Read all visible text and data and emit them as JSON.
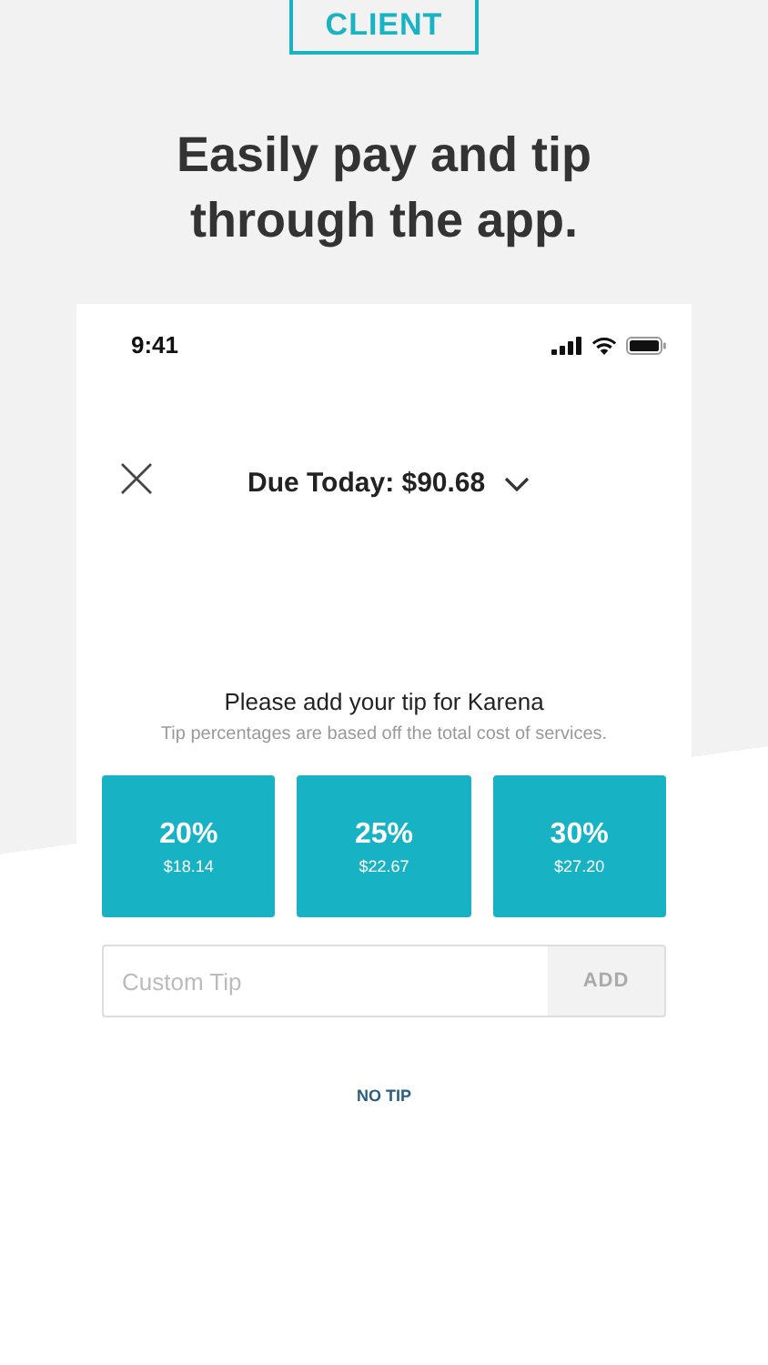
{
  "badge": "CLIENT",
  "headline": "Easily pay and tip through the app.",
  "phone": {
    "status_bar": {
      "time": "9:41"
    },
    "header": {
      "title": "Due Today: $90.68"
    },
    "tip_prompt": {
      "title": "Please add your tip for Karena",
      "subtitle": "Tip percentages are based off the total cost of services."
    },
    "tip_options": [
      {
        "percent": "20%",
        "amount": "$18.14"
      },
      {
        "percent": "25%",
        "amount": "$22.67"
      },
      {
        "percent": "30%",
        "amount": "$27.20"
      }
    ],
    "custom_tip": {
      "placeholder": "Custom Tip",
      "button": "ADD"
    },
    "no_tip": "NO TIP"
  }
}
